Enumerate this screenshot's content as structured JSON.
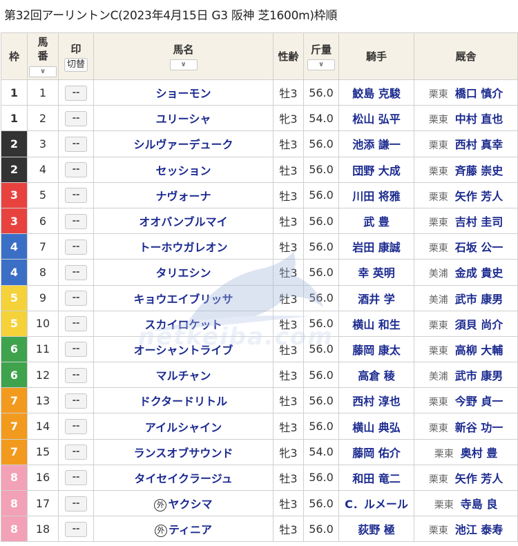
{
  "title": "第32回アーリントンC(2023年4月15日 G3 阪神 芝1600m)枠順",
  "watermark": "netkeiba.com",
  "headers": {
    "waku": "枠",
    "num_top": "馬",
    "num_bottom": "番",
    "num_sort": "∨",
    "mark": "印",
    "mark_toggle": "切替",
    "name": "馬名",
    "name_sort": "∨",
    "sex": "性齢",
    "weight": "斤量",
    "weight_sort": "∨",
    "jockey": "騎手",
    "trainer": "厩舎"
  },
  "mark_placeholder": "--",
  "gaikoku_mark": "外",
  "rows": [
    {
      "waku": "1",
      "num": "1",
      "name": "ショーモン",
      "sex": "牡3",
      "weight": "56.0",
      "jockey": "鮫島 克駿",
      "area": "栗東",
      "trainer": "橋口 慎介",
      "waku_class": "w1",
      "foreign": false
    },
    {
      "waku": "1",
      "num": "2",
      "name": "ユリーシャ",
      "sex": "牝3",
      "weight": "54.0",
      "jockey": "松山 弘平",
      "area": "栗東",
      "trainer": "中村 直也",
      "waku_class": "w1",
      "foreign": false
    },
    {
      "waku": "2",
      "num": "3",
      "name": "シルヴァーデューク",
      "sex": "牡3",
      "weight": "56.0",
      "jockey": "池添 謙一",
      "area": "栗東",
      "trainer": "西村 真幸",
      "waku_class": "w2",
      "foreign": false
    },
    {
      "waku": "2",
      "num": "4",
      "name": "セッション",
      "sex": "牡3",
      "weight": "56.0",
      "jockey": "団野 大成",
      "area": "栗東",
      "trainer": "斉藤 崇史",
      "waku_class": "w2",
      "foreign": false
    },
    {
      "waku": "3",
      "num": "5",
      "name": "ナヴォーナ",
      "sex": "牡3",
      "weight": "56.0",
      "jockey": "川田 将雅",
      "area": "栗東",
      "trainer": "矢作 芳人",
      "waku_class": "w3",
      "foreign": false
    },
    {
      "waku": "3",
      "num": "6",
      "name": "オオバンブルマイ",
      "sex": "牡3",
      "weight": "56.0",
      "jockey": "武 豊",
      "area": "栗東",
      "trainer": "吉村 圭司",
      "waku_class": "w3",
      "foreign": false
    },
    {
      "waku": "4",
      "num": "7",
      "name": "トーホウガレオン",
      "sex": "牡3",
      "weight": "56.0",
      "jockey": "岩田 康誠",
      "area": "栗東",
      "trainer": "石坂 公一",
      "waku_class": "w4",
      "foreign": false
    },
    {
      "waku": "4",
      "num": "8",
      "name": "タリエシン",
      "sex": "牡3",
      "weight": "56.0",
      "jockey": "幸 英明",
      "area": "美浦",
      "trainer": "金成 貴史",
      "waku_class": "w4",
      "foreign": false
    },
    {
      "waku": "5",
      "num": "9",
      "name": "キョウエイブリッサ",
      "sex": "牡3",
      "weight": "56.0",
      "jockey": "酒井 学",
      "area": "美浦",
      "trainer": "武市 康男",
      "waku_class": "w5",
      "foreign": false
    },
    {
      "waku": "5",
      "num": "10",
      "name": "スカイロケット",
      "sex": "牡3",
      "weight": "56.0",
      "jockey": "横山 和生",
      "area": "栗東",
      "trainer": "須貝 尚介",
      "waku_class": "w5",
      "foreign": false
    },
    {
      "waku": "6",
      "num": "11",
      "name": "オーシャントライブ",
      "sex": "牡3",
      "weight": "56.0",
      "jockey": "藤岡 康太",
      "area": "栗東",
      "trainer": "高柳 大輔",
      "waku_class": "w6",
      "foreign": false
    },
    {
      "waku": "6",
      "num": "12",
      "name": "マルチャン",
      "sex": "牡3",
      "weight": "56.0",
      "jockey": "高倉 稜",
      "area": "美浦",
      "trainer": "武市 康男",
      "waku_class": "w6",
      "foreign": false
    },
    {
      "waku": "7",
      "num": "13",
      "name": "ドクタードリトル",
      "sex": "牡3",
      "weight": "56.0",
      "jockey": "西村 淳也",
      "area": "栗東",
      "trainer": "今野 貞一",
      "waku_class": "w7",
      "foreign": false
    },
    {
      "waku": "7",
      "num": "14",
      "name": "アイルシャイン",
      "sex": "牡3",
      "weight": "56.0",
      "jockey": "横山 典弘",
      "area": "栗東",
      "trainer": "新谷 功一",
      "waku_class": "w7",
      "foreign": false
    },
    {
      "waku": "7",
      "num": "15",
      "name": "ランスオブサウンド",
      "sex": "牝3",
      "weight": "54.0",
      "jockey": "藤岡 佑介",
      "area": "栗東",
      "trainer": "奥村 豊",
      "waku_class": "w7",
      "foreign": false
    },
    {
      "waku": "8",
      "num": "16",
      "name": "タイセイクラージュ",
      "sex": "牡3",
      "weight": "56.0",
      "jockey": "和田 竜二",
      "area": "栗東",
      "trainer": "矢作 芳人",
      "waku_class": "w8",
      "foreign": false
    },
    {
      "waku": "8",
      "num": "17",
      "name": "ヤクシマ",
      "sex": "牡3",
      "weight": "56.0",
      "jockey": "C．ルメール",
      "area": "栗東",
      "trainer": "寺島 良",
      "waku_class": "w8",
      "foreign": true
    },
    {
      "waku": "8",
      "num": "18",
      "name": "ティニア",
      "sex": "牡3",
      "weight": "56.0",
      "jockey": "荻野 極",
      "area": "栗東",
      "trainer": "池江 泰寿",
      "waku_class": "w8",
      "foreign": true
    }
  ]
}
